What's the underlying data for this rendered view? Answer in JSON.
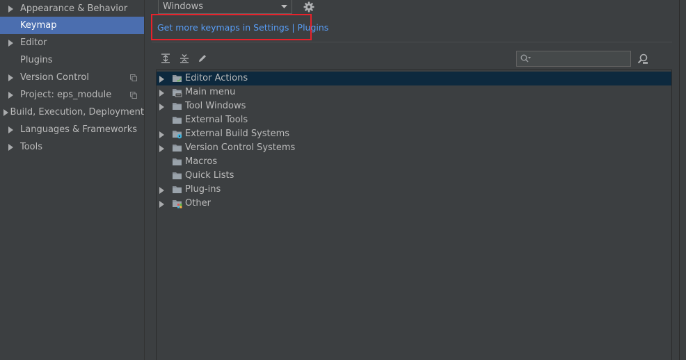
{
  "sidebar": {
    "items": [
      {
        "label": "Appearance & Behavior",
        "expandable": true,
        "selected": false,
        "project_icon": false
      },
      {
        "label": "Keymap",
        "expandable": false,
        "selected": true,
        "project_icon": false
      },
      {
        "label": "Editor",
        "expandable": true,
        "selected": false,
        "project_icon": false
      },
      {
        "label": "Plugins",
        "expandable": false,
        "selected": false,
        "project_icon": false
      },
      {
        "label": "Version Control",
        "expandable": true,
        "selected": false,
        "project_icon": true
      },
      {
        "label": "Project: eps_module",
        "expandable": true,
        "selected": false,
        "project_icon": true
      },
      {
        "label": "Build, Execution, Deployment",
        "expandable": true,
        "selected": false,
        "project_icon": false
      },
      {
        "label": "Languages & Frameworks",
        "expandable": true,
        "selected": false,
        "project_icon": false
      },
      {
        "label": "Tools",
        "expandable": true,
        "selected": false,
        "project_icon": false
      }
    ]
  },
  "keymap": {
    "selected": "Windows",
    "get_more_link": "Get more keymaps in Settings | Plugins"
  },
  "toolbar": {
    "icons": [
      "expand-all-icon",
      "collapse-all-icon",
      "edit-shortcut-icon"
    ]
  },
  "search": {
    "value": "",
    "placeholder": ""
  },
  "tree": {
    "rows": [
      {
        "label": "Editor Actions",
        "expandable": true,
        "selected": true,
        "icon": "editor-actions-folder-icon"
      },
      {
        "label": "Main menu",
        "expandable": true,
        "selected": false,
        "icon": "main-menu-folder-icon"
      },
      {
        "label": "Tool Windows",
        "expandable": true,
        "selected": false,
        "icon": "folder-icon"
      },
      {
        "label": "External Tools",
        "expandable": false,
        "selected": false,
        "icon": "folder-icon"
      },
      {
        "label": "External Build Systems",
        "expandable": true,
        "selected": false,
        "icon": "build-systems-folder-icon"
      },
      {
        "label": "Version Control Systems",
        "expandable": true,
        "selected": false,
        "icon": "folder-icon"
      },
      {
        "label": "Macros",
        "expandable": false,
        "selected": false,
        "icon": "folder-icon"
      },
      {
        "label": "Quick Lists",
        "expandable": false,
        "selected": false,
        "icon": "folder-icon"
      },
      {
        "label": "Plug-ins",
        "expandable": true,
        "selected": false,
        "icon": "folder-icon"
      },
      {
        "label": "Other",
        "expandable": true,
        "selected": false,
        "icon": "other-folder-icon"
      }
    ]
  },
  "colors": {
    "background": "#3c3f41",
    "selection_sidebar": "#4b6eaf",
    "selection_tree": "#0d293e",
    "link": "#589df6",
    "highlight_box": "#e8222b"
  }
}
